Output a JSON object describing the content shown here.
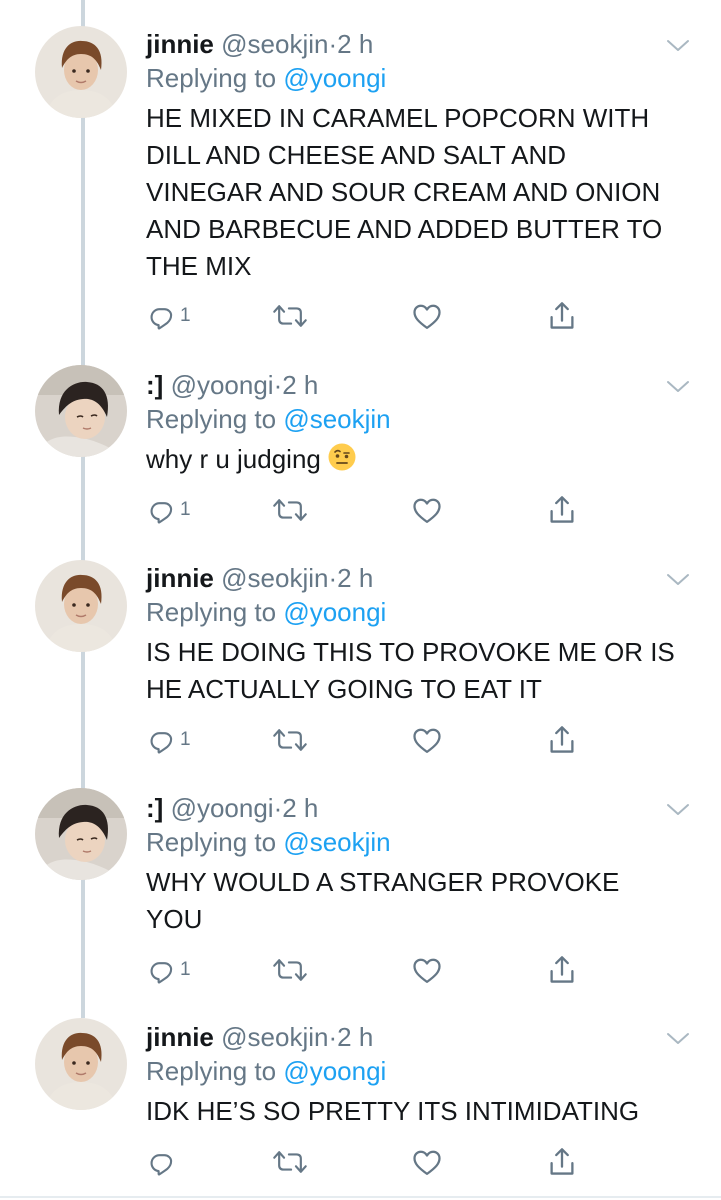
{
  "tweets": [
    {
      "name": "jinnie",
      "handle": "@seokjin",
      "time": "2 h",
      "replying_prefix": "Replying to",
      "replying_to": "@yoongi",
      "text_lines": [
        "HE MIXED IN CARAMEL POPCORN WITH",
        "DILL AND CHEESE AND SALT AND",
        "VINEGAR AND SOUR CREAM AND ONION",
        "AND BARBECUE AND ADDED BUTTER TO",
        "THE MIX"
      ],
      "reply_count": "1",
      "avatar": "seokjin"
    },
    {
      "name": ":]",
      "handle": "@yoongi",
      "time": "2 h",
      "replying_prefix": "Replying to",
      "replying_to": "@seokjin",
      "text_lines": [
        "why r u judging"
      ],
      "emoji": "face-with-raised-eyebrow",
      "reply_count": "1",
      "avatar": "yoongi"
    },
    {
      "name": "jinnie",
      "handle": "@seokjin",
      "time": "2 h",
      "replying_prefix": "Replying to",
      "replying_to": "@yoongi",
      "text_lines": [
        "IS HE DOING THIS TO PROVOKE ME OR IS",
        "HE ACTUALLY GOING TO EAT IT"
      ],
      "reply_count": "1",
      "avatar": "seokjin"
    },
    {
      "name": ":]",
      "handle": "@yoongi",
      "time": "2 h",
      "replying_prefix": "Replying to",
      "replying_to": "@seokjin",
      "text_lines": [
        "WHY WOULD A STRANGER PROVOKE",
        "YOU"
      ],
      "reply_count": "1",
      "avatar": "yoongi"
    },
    {
      "name": "jinnie",
      "handle": "@seokjin",
      "time": "2 h",
      "replying_prefix": "Replying to",
      "replying_to": "@yoongi",
      "text_lines": [
        "IDK HE’S SO PRETTY ITS INTIMIDATING"
      ],
      "reply_count": "",
      "avatar": "seokjin"
    }
  ],
  "separator": "·",
  "colors": {
    "text": "#14171a",
    "secondary": "#657786",
    "link": "#1da1f2",
    "thread_line": "#ccd6dd"
  },
  "icons": {
    "reply": "reply-icon",
    "retweet": "retweet-icon",
    "like": "heart-icon",
    "share": "share-icon",
    "menu": "chevron-down-icon"
  }
}
